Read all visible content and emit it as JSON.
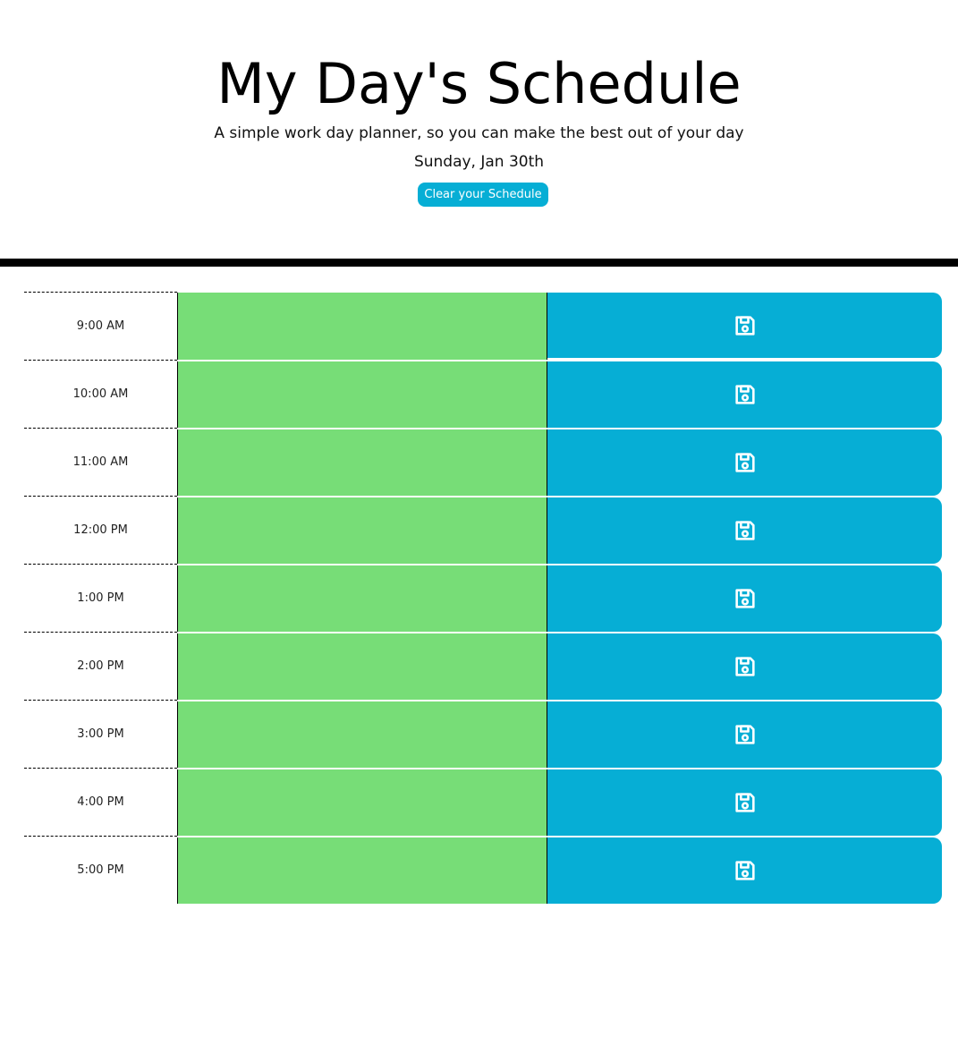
{
  "header": {
    "title": "My Day's Schedule",
    "subtitle": "A simple work day planner, so you can make the best out of your day",
    "current_day": "Sunday, Jan 30th",
    "clear_label": "Clear your Schedule"
  },
  "colors": {
    "present_or_future_block": "#77DD77",
    "save_button": "#06AED5",
    "clear_button": "#06AED5"
  },
  "schedule": {
    "save_icon": "floppy-disk-save-icon",
    "hours": [
      {
        "label": "9:00 AM",
        "text": ""
      },
      {
        "label": "10:00 AM",
        "text": ""
      },
      {
        "label": "11:00 AM",
        "text": ""
      },
      {
        "label": "12:00 PM",
        "text": ""
      },
      {
        "label": "1:00 PM",
        "text": ""
      },
      {
        "label": "2:00 PM",
        "text": ""
      },
      {
        "label": "3:00 PM",
        "text": ""
      },
      {
        "label": "4:00 PM",
        "text": ""
      },
      {
        "label": "5:00 PM",
        "text": ""
      }
    ]
  }
}
